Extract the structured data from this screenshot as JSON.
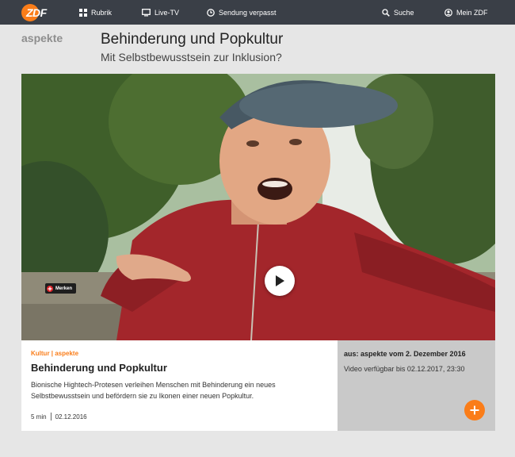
{
  "nav": {
    "logo_text": "ZDF",
    "items": [
      {
        "label": "Rubrik",
        "icon": "grid-icon"
      },
      {
        "label": "Live-TV",
        "icon": "tv-icon"
      },
      {
        "label": "Sendung verpasst",
        "icon": "clock-icon"
      },
      {
        "label": "Suche",
        "icon": "search-icon"
      },
      {
        "label": "Mein ZDF",
        "icon": "user-icon"
      }
    ]
  },
  "header": {
    "brand": "aspekte",
    "title": "Behinderung und Popkultur",
    "subtitle": "Mit Selbstbewusstsein zur Inklusion?"
  },
  "player": {
    "merken_label": "Merken"
  },
  "clip": {
    "category": "Kultur | aspekte",
    "title": "Behinderung und Popkultur",
    "description": "Bionische Hightech-Protesen verleihen Menschen mit Behinderung ein neues Selbstbewusstsein und befördern sie zu Ikonen einer neuen Popkultur.",
    "duration": "5 min",
    "date": "02.12.2016"
  },
  "side": {
    "source": "aus: aspekte vom 2. Dezember 2016",
    "availability": "Video verfügbar bis 02.12.2017, 23:30"
  },
  "colors": {
    "accent": "#fa7d19",
    "nav_bg": "#3a3f47",
    "page_bg": "#e6e6e6",
    "side_bg": "#c9c9c9"
  }
}
